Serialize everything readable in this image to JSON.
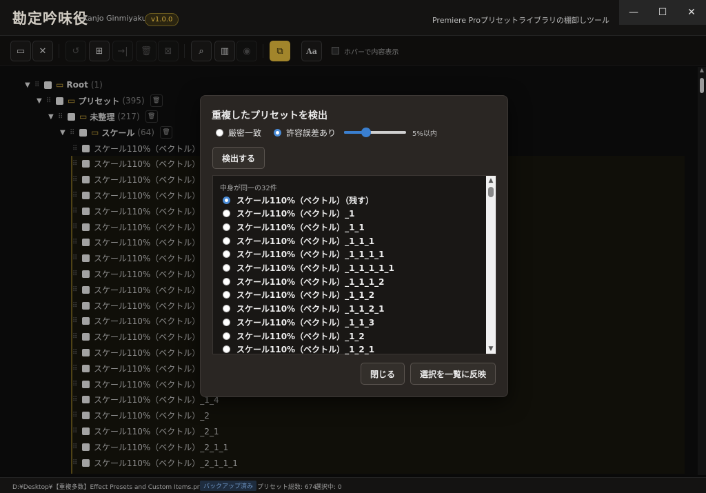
{
  "app": {
    "title": "勘定吟味役",
    "subtitle": "Kanjo Ginmiyaku",
    "version": "v1.0.0",
    "description": "Premiere Proプリセットライブラリの棚卸しツール"
  },
  "window": {
    "min": "—",
    "max": "☐",
    "close": "✕"
  },
  "toolbar": {
    "hover_label": "ホバーで内容表示",
    "font_button": "Aa"
  },
  "tree": {
    "root": {
      "label": "Root",
      "count": "(1)"
    },
    "presets": {
      "label": "プリセット",
      "count": "(395)"
    },
    "unsorted": {
      "label": "未整理",
      "count": "(217)"
    },
    "scale": {
      "label": "スケール",
      "count": "(64)"
    },
    "items": [
      "スケール110%（ベクトル）",
      "スケール110%（ベクトル）_1",
      "スケール110%（ベクトル）_1",
      "スケール110%（ベクトル）_1",
      "スケール110%（ベクトル）_1",
      "スケール110%（ベクトル）_1",
      "スケール110%（ベクトル）_1",
      "スケール110%（ベクトル）_1",
      "スケール110%（ベクトル）_1",
      "スケール110%（ベクトル）_1",
      "スケール110%（ベクトル）_1",
      "スケール110%（ベクトル）_1",
      "スケール110%（ベクトル）_1",
      "スケール110%（ベクトル）_1",
      "スケール110%（ベクトル）_1",
      "スケール110%（ベクトル）_1",
      "スケール110%（ベクトル）_1_4",
      "スケール110%（ベクトル）_2",
      "スケール110%（ベクトル）_2_1",
      "スケール110%（ベクトル）_2_1_1",
      "スケール110%（ベクトル）_2_1_1_1"
    ]
  },
  "status": {
    "path": "D:¥Desktop¥【重複多数】Effect Presets and Custom Items.prfpset",
    "backup": "バックアップ済み",
    "total": "プリセット総数: 674",
    "selected": "選択中: 0"
  },
  "modal": {
    "title": "重複したプリセットを検出",
    "option_strict": "厳密一致",
    "option_tolerance": "許容誤差あり",
    "tolerance_value": "5%以内",
    "tolerance_level": 0.35,
    "detect_button": "検出する",
    "group_header": "中身が同一の32件",
    "items": [
      "スケール110%（ベクトル）（残す）",
      "スケール110%（ベクトル）_1",
      "スケール110%（ベクトル）_1_1",
      "スケール110%（ベクトル）_1_1_1",
      "スケール110%（ベクトル）_1_1_1_1",
      "スケール110%（ベクトル）_1_1_1_1_1",
      "スケール110%（ベクトル）_1_1_1_2",
      "スケール110%（ベクトル）_1_1_2",
      "スケール110%（ベクトル）_1_1_2_1",
      "スケール110%（ベクトル）_1_1_3",
      "スケール110%（ベクトル）_1_2",
      "スケール110%（ベクトル）_1_2_1"
    ],
    "close_button": "閉じる",
    "apply_button": "選択を一覧に反映"
  }
}
